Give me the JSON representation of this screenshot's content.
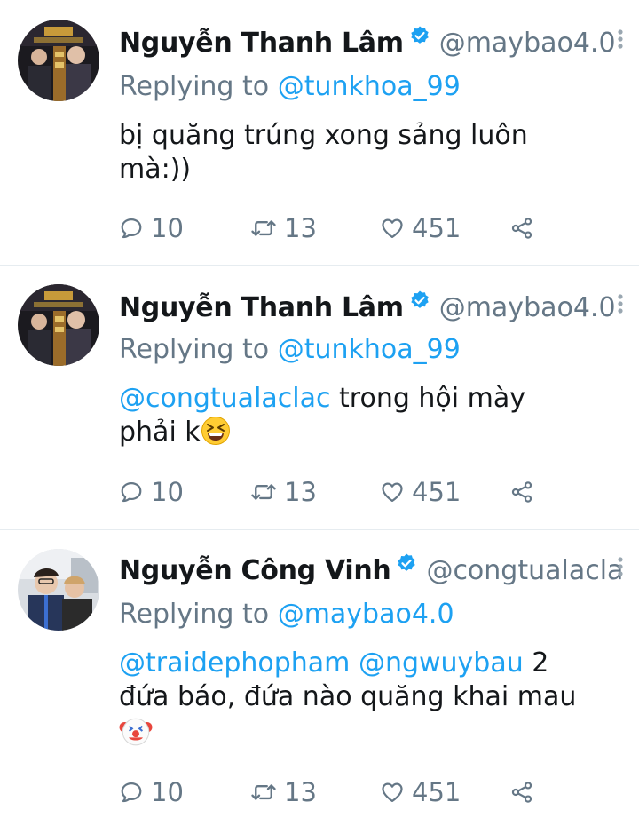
{
  "colors": {
    "accent": "#1da1f2",
    "muted": "#657786",
    "text": "#14171a",
    "divider": "#e6ecf0"
  },
  "tweets": [
    {
      "name": "Nguyễn Thanh Lâm",
      "handle": "@maybao4.0",
      "replying_prefix": "Replying to",
      "replying_to": "@tunkhoa_99",
      "text_line1": "bị quăng trúng xong sảng luôn",
      "text_line2": "mà:))",
      "replies": "10",
      "retweets": "13",
      "likes": "451"
    },
    {
      "name": "Nguyễn Thanh Lâm",
      "handle": "@maybao4.0",
      "replying_prefix": "Replying to",
      "replying_to": "@tunkhoa_99",
      "mention1": "@congtualaclac",
      "text_rest1": " trong hội mày",
      "text_line2": "phải k",
      "emoji": "grinning-squinting-face-emoji",
      "replies": "10",
      "retweets": "13",
      "likes": "451"
    },
    {
      "name": "Nguyễn Công Vinh",
      "handle": "@congtualacla",
      "replying_prefix": "Replying to",
      "replying_to": "@maybao4.0",
      "mention1": "@traidephopham",
      "mention2": "@ngwuybau",
      "text_rest1": " 2",
      "text_line2": "đứa báo, đứa nào quăng khai mau",
      "emoji": "clown-face-emoji",
      "replies": "10",
      "retweets": "13",
      "likes": "451"
    }
  ],
  "icons": [
    "reply-icon",
    "retweet-icon",
    "like-icon",
    "share-icon",
    "verified-icon",
    "more-caret-icon"
  ]
}
